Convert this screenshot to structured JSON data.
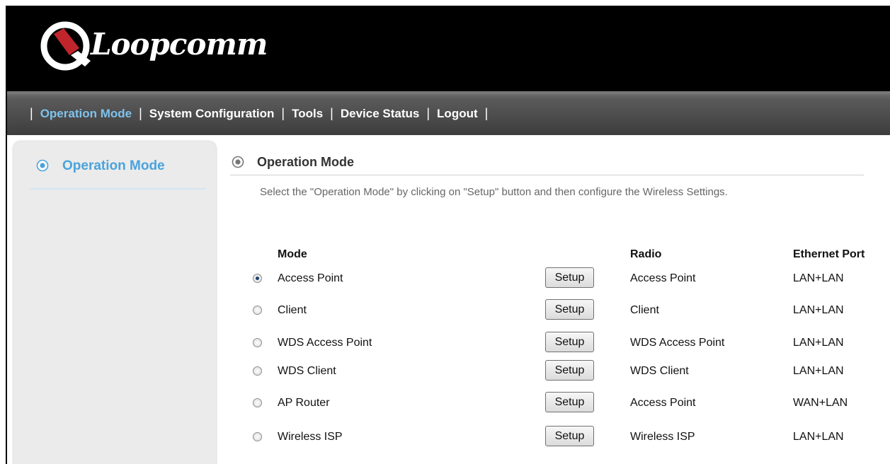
{
  "brand": {
    "name": "Loopcomm"
  },
  "nav": {
    "items": [
      {
        "label": "Operation Mode"
      },
      {
        "label": "System Configuration"
      },
      {
        "label": "Tools"
      },
      {
        "label": "Device Status"
      },
      {
        "label": "Logout"
      }
    ],
    "active_index": 0,
    "separator": "|"
  },
  "sidebar": {
    "items": [
      {
        "label": "Operation Mode"
      }
    ]
  },
  "section": {
    "title": "Operation Mode",
    "description": "Select the \"Operation Mode\" by clicking on \"Setup\" button and then configure the Wireless Settings."
  },
  "table": {
    "headers": {
      "mode": "Mode",
      "radio": "Radio",
      "ethernet": "Ethernet Port"
    },
    "button_label": "Setup",
    "rows": [
      {
        "mode": "Access Point",
        "radio": "Access Point",
        "ethernet": "LAN+LAN",
        "selected": true
      },
      {
        "mode": "Client",
        "radio": "Client",
        "ethernet": "LAN+LAN",
        "selected": false
      },
      {
        "mode": "WDS Access Point",
        "radio": "WDS Access Point",
        "ethernet": "LAN+LAN",
        "selected": false
      },
      {
        "mode": "WDS Client",
        "radio": "WDS Client",
        "ethernet": "LAN+LAN",
        "selected": false
      },
      {
        "mode": "AP Router",
        "radio": "Access Point",
        "ethernet": "WAN+LAN",
        "selected": false
      },
      {
        "mode": "Wireless ISP",
        "radio": "Wireless ISP",
        "ethernet": "LAN+LAN",
        "selected": false
      }
    ]
  },
  "colors": {
    "active_nav": "#7ec3ec",
    "sidebar_accent": "#4aa3dc",
    "logo_red": "#c0252b"
  },
  "icons": {
    "section_bullet": "radio-bullet-icon",
    "logo": "loopcomm-logo-icon"
  }
}
